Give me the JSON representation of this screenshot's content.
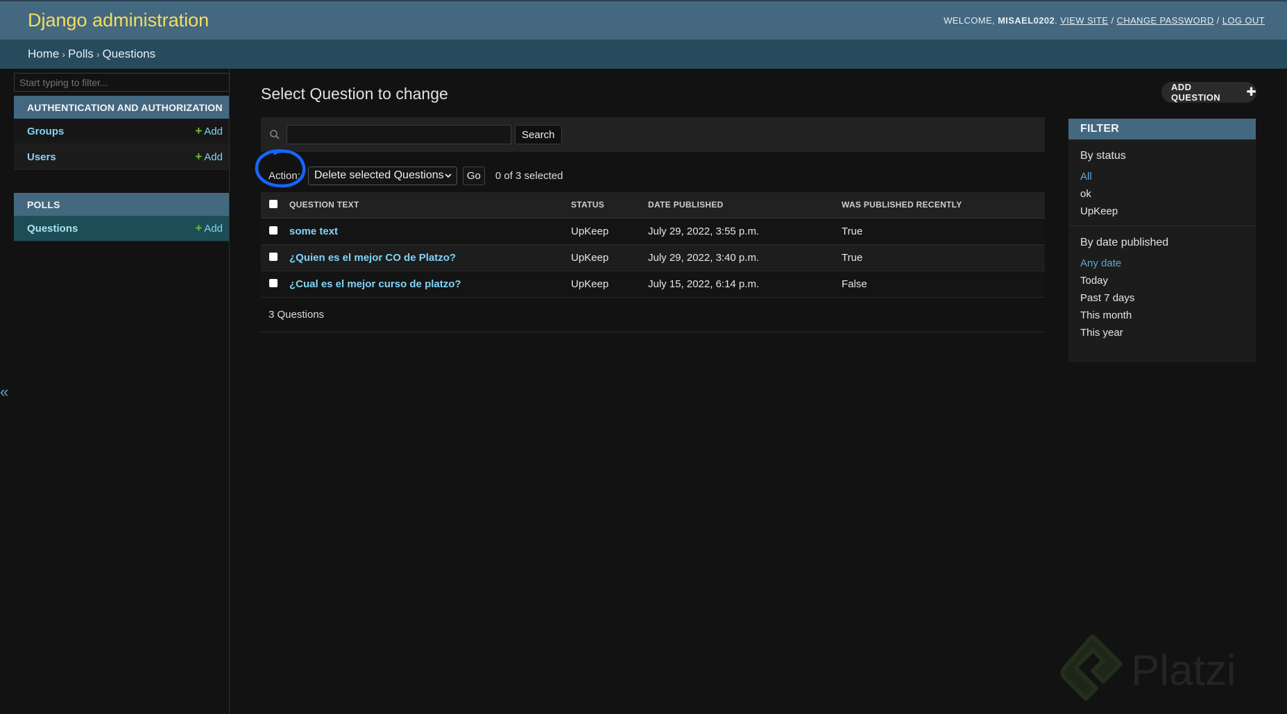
{
  "header": {
    "site_name": "Django administration",
    "welcome": "WELCOME,",
    "username": "MISAEL0202",
    "view_site": "VIEW SITE",
    "change_password": "CHANGE PASSWORD",
    "log_out": "LOG OUT",
    "separator": "/"
  },
  "breadcrumbs": [
    "Home",
    "Polls",
    "Questions"
  ],
  "sidebar": {
    "filter_placeholder": "Start typing to filter...",
    "apps": [
      {
        "caption": "AUTHENTICATION AND AUTHORIZATION",
        "models": [
          {
            "name": "Groups",
            "add": "Add"
          },
          {
            "name": "Users",
            "add": "Add"
          }
        ]
      },
      {
        "caption": "POLLS",
        "models": [
          {
            "name": "Questions",
            "add": "Add"
          }
        ]
      }
    ],
    "collapse_glyph": "«"
  },
  "content": {
    "title": "Select Question to change",
    "add_button": "ADD QUESTION",
    "search_button": "Search",
    "action_label": "Action:",
    "action_selected": "Delete selected Questions",
    "go_button": "Go",
    "selection_counter": "0 of 3 selected",
    "columns": [
      "QUESTION TEXT",
      "STATUS",
      "DATE PUBLISHED",
      "WAS PUBLISHED RECENTLY"
    ],
    "rows": [
      {
        "question": "some text",
        "status": "UpKeep",
        "date": "July 29, 2022, 3:55 p.m.",
        "recent": "True"
      },
      {
        "question": "¿Quien es el mejor CO de Platzo?",
        "status": "UpKeep",
        "date": "July 29, 2022, 3:40 p.m.",
        "recent": "True"
      },
      {
        "question": "¿Cual es el mejor curso de platzo?",
        "status": "UpKeep",
        "date": "July 15, 2022, 6:14 p.m.",
        "recent": "False"
      }
    ],
    "paginator": "3 Questions"
  },
  "filter": {
    "title": "FILTER",
    "by_status": {
      "heading": "By status",
      "options": [
        "All",
        "ok",
        "UpKeep"
      ],
      "selected": "All"
    },
    "by_date": {
      "heading": "By date published",
      "options": [
        "Any date",
        "Today",
        "Past 7 days",
        "This month",
        "This year"
      ],
      "selected": "Any date"
    }
  },
  "watermark": "Platzi",
  "colors": {
    "header_bg": "#44687f",
    "site_name": "#f5dd5d",
    "link": "#81d4fa",
    "add_plus": "#70bf2b",
    "annotation": "#1565ff"
  }
}
